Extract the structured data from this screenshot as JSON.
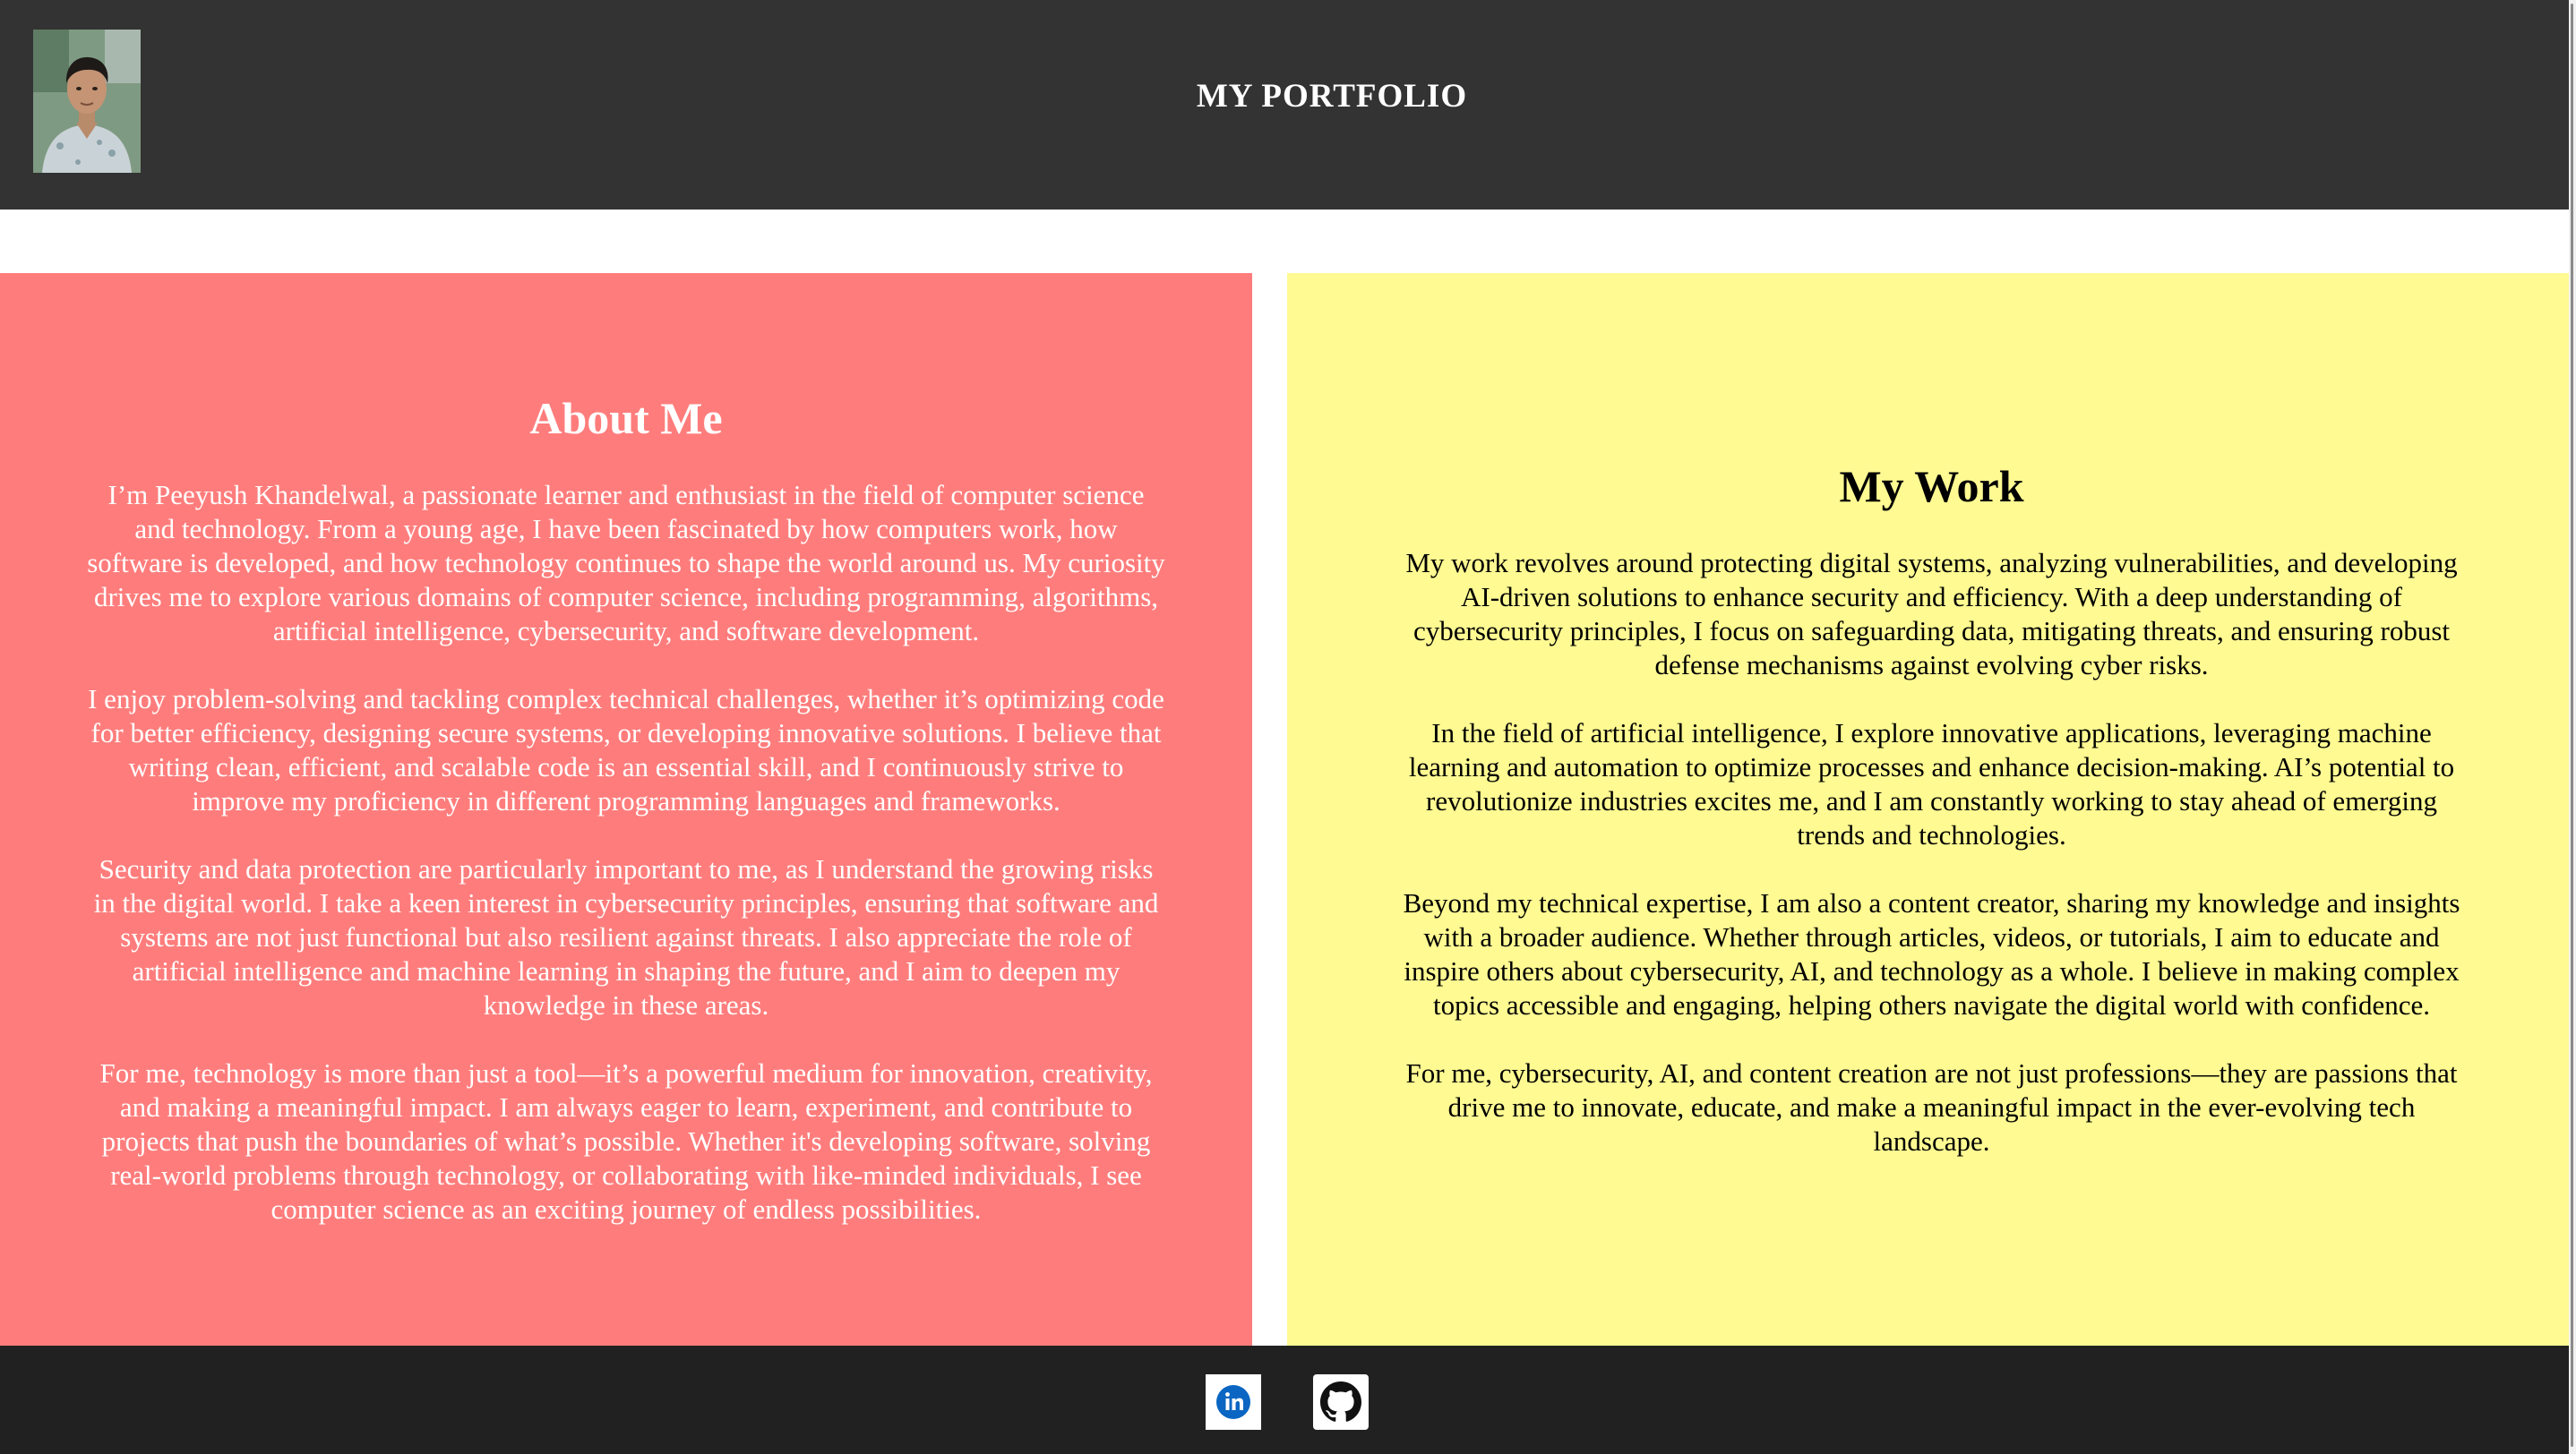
{
  "header": {
    "title": "MY PORTFOLIO",
    "avatar_icon": "profile-photo"
  },
  "about": {
    "heading": "About Me",
    "paragraphs": [
      "I’m Peeyush Khandelwal, a passionate learner and enthusiast in the field of computer science and technology. From a young age, I have been fascinated by how computers work, how software is developed, and how technology continues to shape the world around us. My curiosity drives me to explore various domains of computer science, including programming, algorithms, artificial intelligence, cybersecurity, and software development.",
      "I enjoy problem-solving and tackling complex technical challenges, whether it’s optimizing code for better efficiency, designing secure systems, or developing innovative solutions. I believe that writing clean, efficient, and scalable code is an essential skill, and I continuously strive to improve my proficiency in different programming languages and frameworks.",
      "Security and data protection are particularly important to me, as I understand the growing risks in the digital world. I take a keen interest in cybersecurity principles, ensuring that software and systems are not just functional but also resilient against threats. I also appreciate the role of artificial intelligence and machine learning in shaping the future, and I aim to deepen my knowledge in these areas.",
      "For me, technology is more than just a tool—it’s a powerful medium for innovation, creativity, and making a meaningful impact. I am always eager to learn, experiment, and contribute to projects that push the boundaries of what’s possible. Whether it's developing software, solving real-world problems through technology, or collaborating with like-minded individuals, I see computer science as an exciting journey of endless possibilities."
    ]
  },
  "work": {
    "heading": "My Work",
    "paragraphs": [
      "My work revolves around protecting digital systems, analyzing vulnerabilities, and developing AI-driven solutions to enhance security and efficiency. With a deep understanding of cybersecurity principles, I focus on safeguarding data, mitigating threats, and ensuring robust defense mechanisms against evolving cyber risks.",
      "In the field of artificial intelligence, I explore innovative applications, leveraging machine learning and automation to optimize processes and enhance decision-making. AI’s potential to revolutionize industries excites me, and I am constantly working to stay ahead of emerging trends and technologies.",
      "Beyond my technical expertise, I am also a content creator, sharing my knowledge and insights with a broader audience. Whether through articles, videos, or tutorials, I aim to educate and inspire others about cybersecurity, AI, and technology as a whole. I believe in making complex topics accessible and engaging, helping others navigate the digital world with confidence.",
      "For me, cybersecurity, AI, and content creation are not just professions—they are passions that drive me to innovate, educate, and make a meaningful impact in the ever-evolving tech landscape."
    ]
  },
  "footer": {
    "links": [
      {
        "icon": "linkedin-icon",
        "color": "#0a66c2"
      },
      {
        "icon": "github-icon",
        "color": "#ffffff"
      }
    ]
  },
  "colors": {
    "header_bg": "#333333",
    "about_bg": "#fe7d7c",
    "work_bg": "#fffa92",
    "footer_bg": "#212121"
  }
}
